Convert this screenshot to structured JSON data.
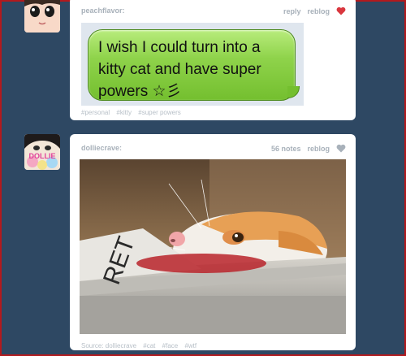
{
  "posts": [
    {
      "username": "peachflavor:",
      "reply_label": "reply",
      "reblog_label": "reblog",
      "liked": true,
      "message_text": "I wish I could turn into a kitty cat and have super powers ☆彡",
      "tags": [
        "#personal",
        "#kitty",
        "#super powers"
      ]
    },
    {
      "username": "dolliecrave:",
      "notes_label": "56 notes",
      "reblog_label": "reblog",
      "liked": false,
      "source_label": "Source: dolliecrave",
      "tags": [
        "#cat",
        "#face",
        "#wtf"
      ]
    }
  ],
  "colors": {
    "dashboard_bg": "#2e4863",
    "like_active": "#d9363e",
    "like_inactive": "#a8b1ba"
  },
  "avatar_text": "DOLLIE"
}
